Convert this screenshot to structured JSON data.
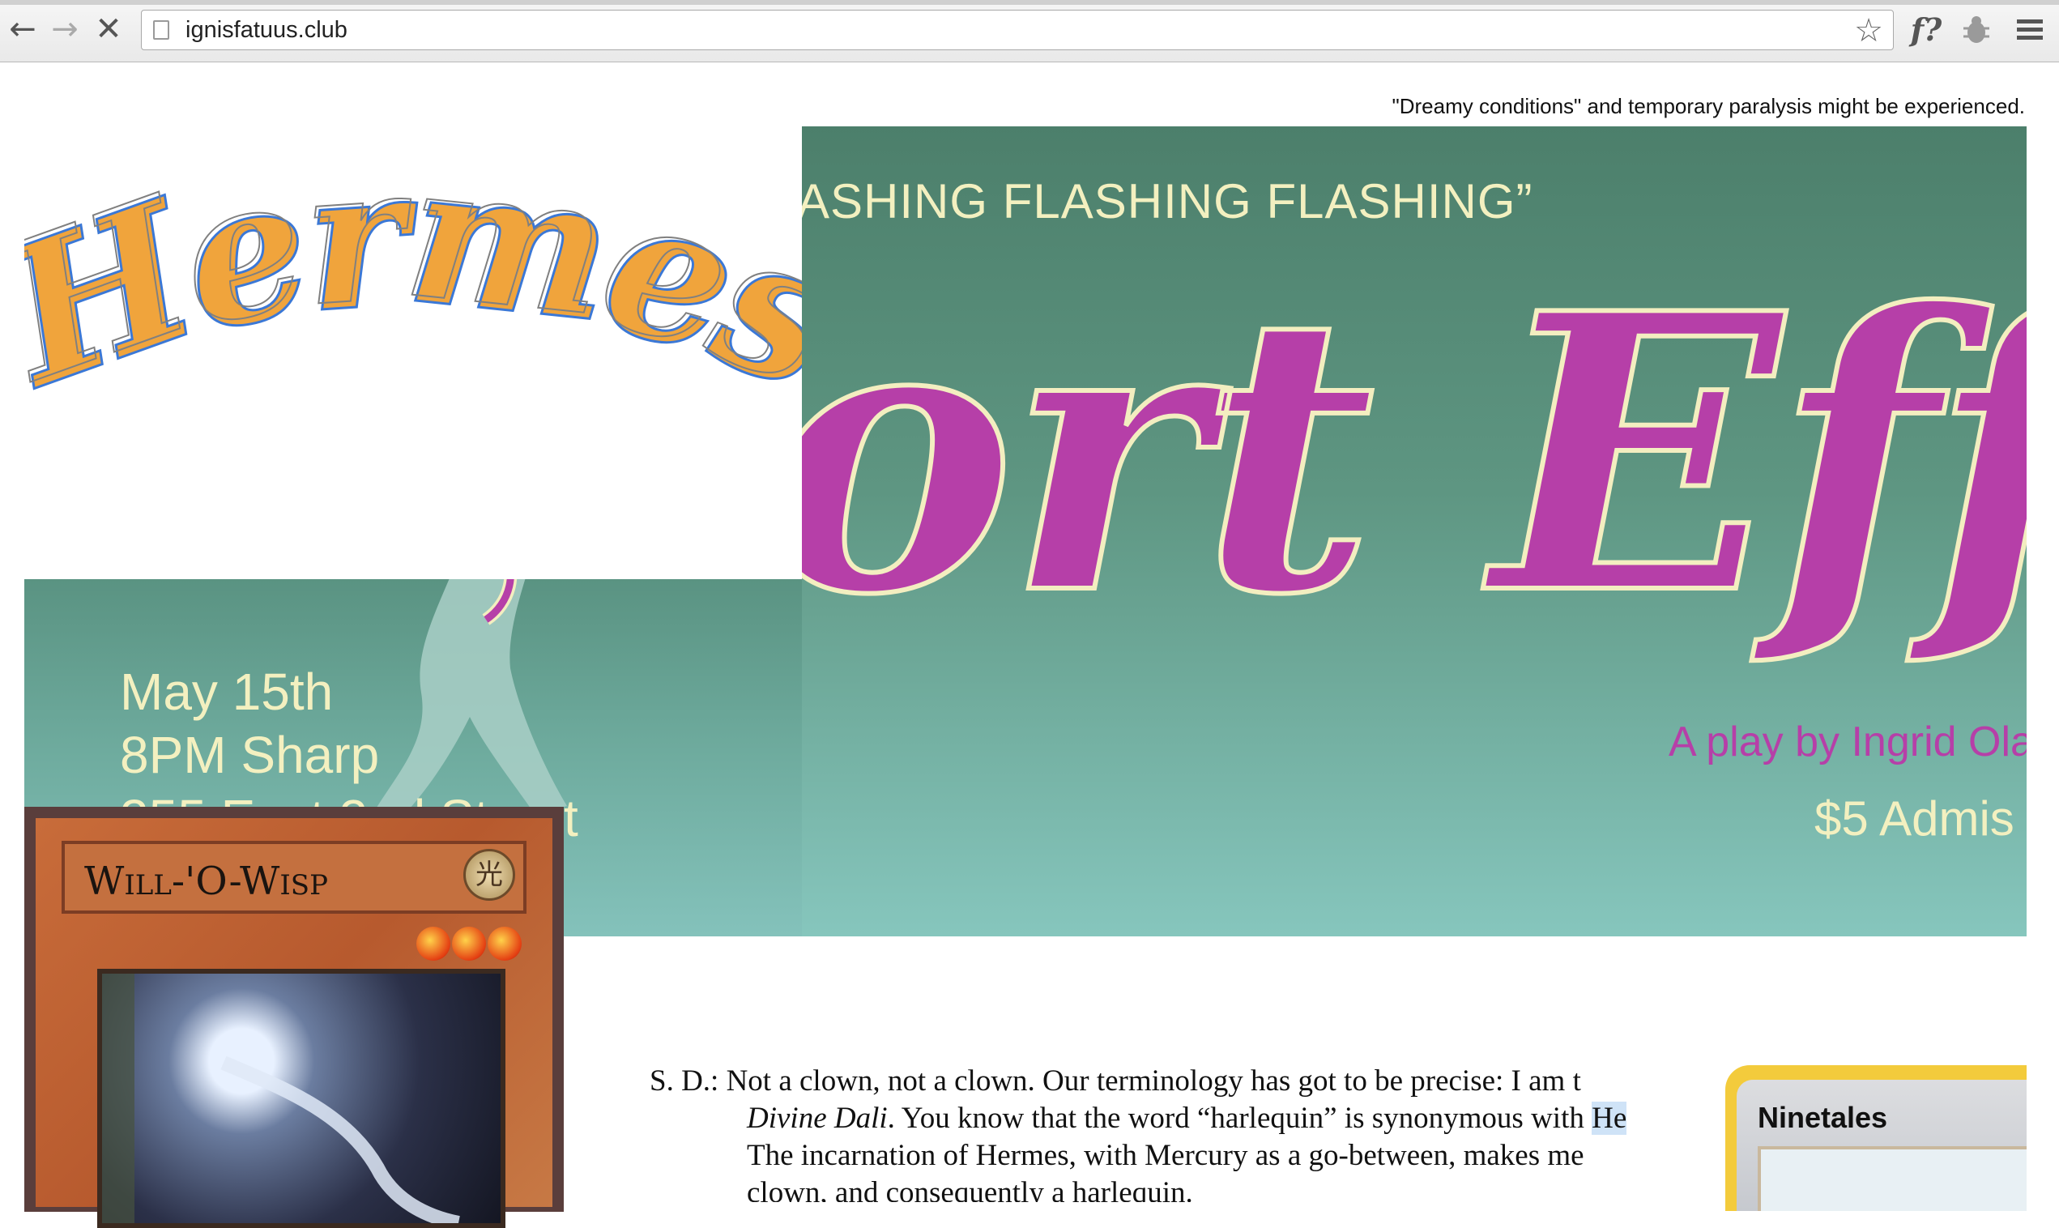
{
  "browser": {
    "back_icon": "back-arrow-icon",
    "forward_icon": "forward-arrow-icon",
    "stop_icon": "stop-loading-icon",
    "url": "ignisfatuus.club",
    "bookmark_icon": "star-icon",
    "extension1_label": "f?",
    "extension2_icon": "bug-icon",
    "menu_icon": "hamburger-menu-icon"
  },
  "page": {
    "disclaimer": "\"Dreamy conditions\" and temporary paralysis might be experienced.",
    "logo_text": "Hermes",
    "poster": {
      "flashing_text": "ASHING FLASHING FLASHING”",
      "title_fragment": "ort Eff",
      "play_by": "A play by Ingrid Ola",
      "admission": "$5 Admis",
      "date": "May 15th",
      "time": "8PM Sharp",
      "address": "355 East 2nd Street"
    },
    "card_wisp": {
      "name": "Will-'O-Wisp",
      "attribute_glyph": "光"
    },
    "card_ninetales": {
      "name": "Ninetales"
    },
    "dialogue": {
      "speaker": "S. D.:",
      "line1": "Not a clown, not a clown. Our terminology has got to be precise: I am t",
      "line2_italic": "Divine Dali",
      "line2_rest": ". You know that the word “harlequin” is synonymous with ",
      "line2_highlight": "He",
      "line3": "The incarnation of Hermes, with Mercury as a go-between, makes me",
      "line4": "clown, and consequently a harlequin."
    },
    "colors": {
      "poster_magenta": "#b63fa8",
      "poster_cream": "#f3f0c0",
      "poster_teal": "#5e9682"
    }
  }
}
